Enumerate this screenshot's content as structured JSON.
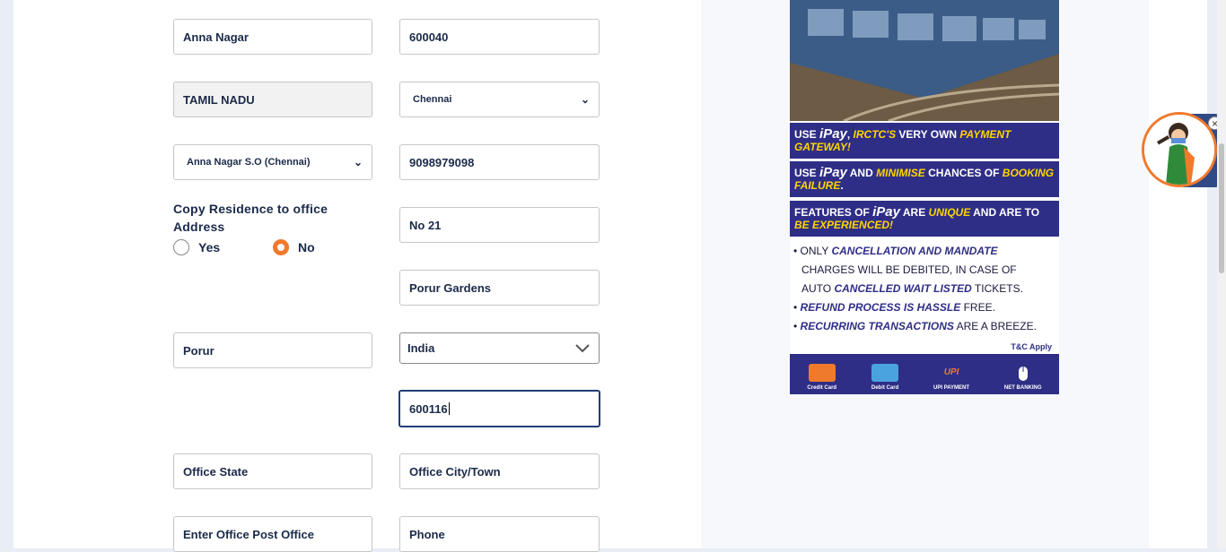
{
  "form": {
    "locality": "Anna Nagar",
    "pincode": "600040",
    "state": "TAMIL NADU",
    "city_selected": "Chennai",
    "post_office_selected": "Anna Nagar S.O (Chennai)",
    "phone": "9098979098",
    "copy_label": "Copy Residence to office Address",
    "radio_yes": "Yes",
    "radio_no": "No",
    "copy_selected": "No",
    "office_flat": "No 21",
    "office_street": "Porur Gardens",
    "office_area": "Porur",
    "office_country_selected": "India",
    "office_pincode": "600116",
    "office_state_placeholder": "Office State",
    "office_city_placeholder": "Office City/Town",
    "office_post_office_placeholder": "Enter Office Post Office",
    "office_phone_placeholder": "Phone"
  },
  "ad": {
    "line1_pre": "USE ",
    "line1_brand": "iPay",
    "line1_mid": ", ",
    "line1_em": "IRCTC'S",
    "line1_post": " VERY OWN ",
    "line1_em2": "PAYMENT GATEWAY!",
    "line2_pre": "USE ",
    "line2_brand": "iPay",
    "line2_mid": " AND ",
    "line2_em": "MINIMISE",
    "line2_post": " CHANCES OF ",
    "line2_em2": "BOOKING FAILURE",
    "line2_end": ".",
    "line3_pre": "FEATURES OF ",
    "line3_brand": "iPay",
    "line3_mid": " ARE ",
    "line3_em": "UNIQUE",
    "line3_post": " AND ARE TO ",
    "line3_em2": "BE EXPERIENCED!",
    "bullet1_pre": "• ONLY ",
    "bullet1_em": "CANCELLATION AND MANDATE",
    "bullet1_post": "CHARGES WILL BE DEBITED, IN CASE OF",
    "bullet1_post2_pre": "AUTO ",
    "bullet1_post2_em": "CANCELLED WAIT LISTED",
    "bullet1_post2_end": " TICKETS.",
    "bullet2_em": "REFUND PROCESS IS HASSLE",
    "bullet2_post": " FREE.",
    "bullet3_em": "RECURRING TRANSACTIONS",
    "bullet3_post": " ARE A BREEZE.",
    "tc": "T&C Apply",
    "pay_credit": "Credit Card",
    "pay_debit": "Debit Card",
    "pay_upi": "UPI PAYMENT",
    "pay_net": "NET BANKING"
  },
  "chatbot": {
    "close_glyph": "×",
    "close_icon": "close-icon"
  },
  "colors": {
    "accent": "#f07a2c",
    "navy": "#213d77",
    "ad_band": "#2f2e86",
    "ad_highlight": "#ffd400"
  }
}
